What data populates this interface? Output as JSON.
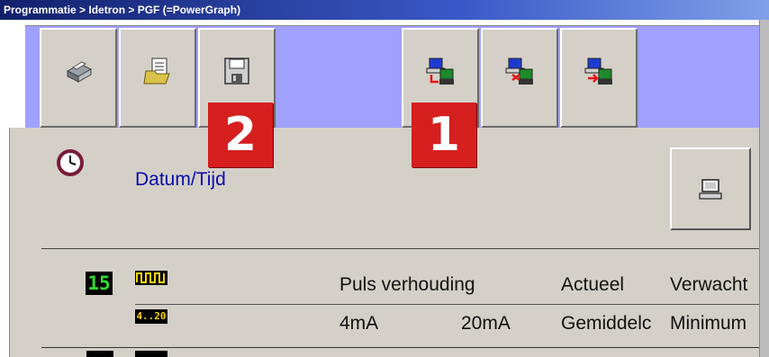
{
  "titlebar": {
    "text": "Programmatie  > Idetron > PGF (=PowerGraph)"
  },
  "toolbar": {
    "buttons": [
      {
        "icon": "printer-icon"
      },
      {
        "icon": "open-folder-icon"
      },
      {
        "icon": "save-disk-icon"
      },
      {
        "icon": "transfer-to-device-icon"
      },
      {
        "icon": "transfer-from-device-icon"
      },
      {
        "icon": "compare-device-icon"
      }
    ]
  },
  "badges": {
    "one": "1",
    "two": "2"
  },
  "datetime": {
    "label": "Datum/Tijd"
  },
  "row1": {
    "lcd": "15",
    "pulse_label": "Puls verhouding",
    "col_actual": "Actueel",
    "col_expected": "Verwacht"
  },
  "row2": {
    "lcd": "4..20",
    "min_ma": "4mA",
    "max_ma": "20mA",
    "col_average": "Gemiddelc",
    "col_minimum": "Minimum"
  },
  "colors": {
    "toolbar_bg": "#a0a0ff",
    "panel_bg": "#d4d0c8",
    "badge_red": "#d61f1f",
    "label_blue": "#0a0ab0"
  }
}
